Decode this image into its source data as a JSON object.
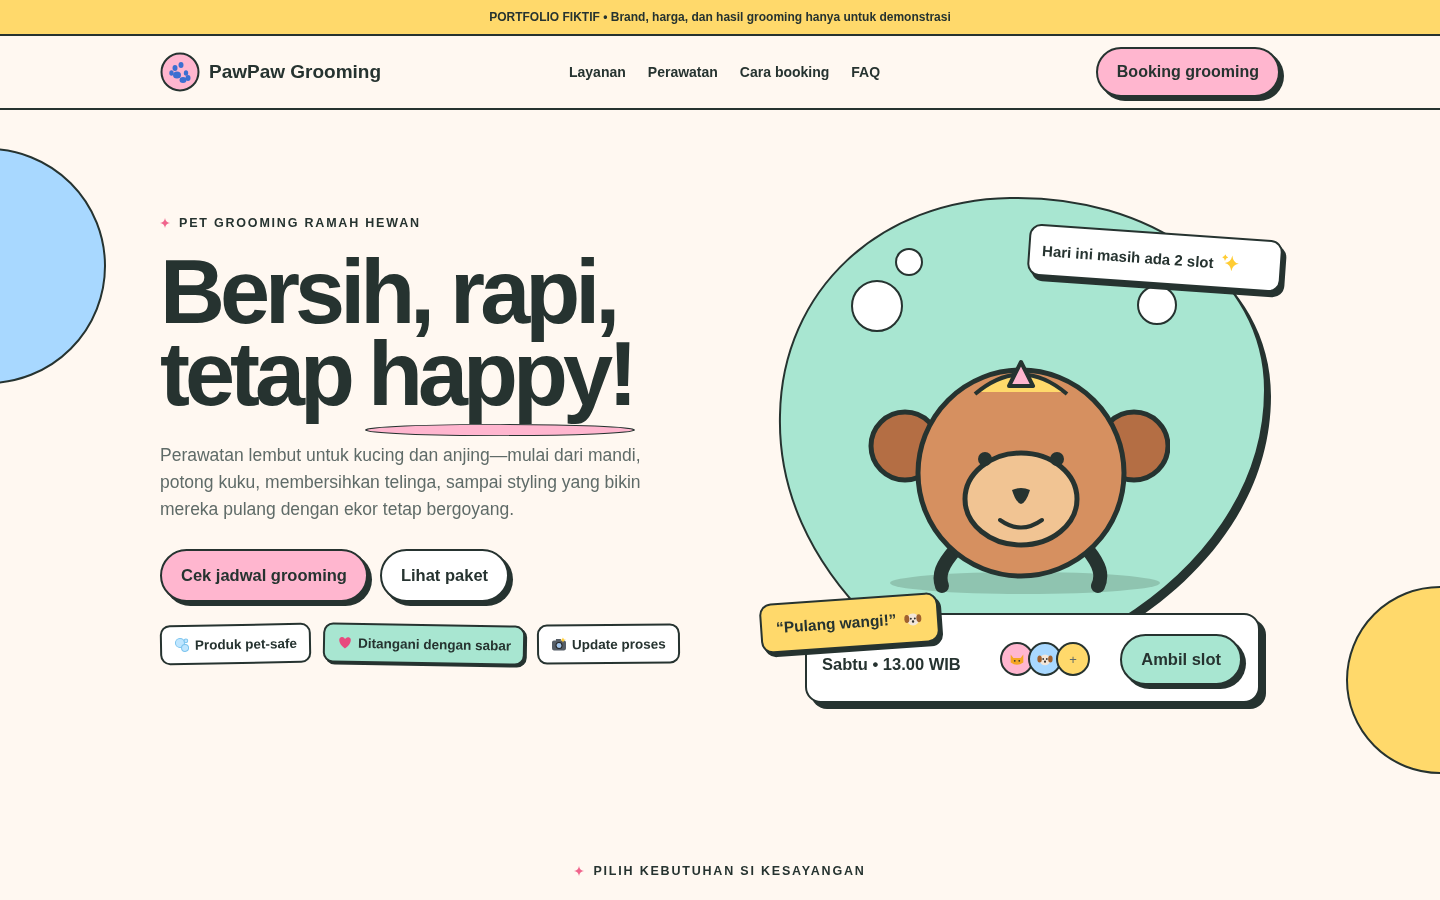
{
  "announcement": "PORTFOLIO FIKTIF • Brand, harga, dan hasil grooming hanya untuk demonstrasi",
  "brand": "PawPaw Grooming",
  "nav": [
    {
      "label": "Layanan"
    },
    {
      "label": "Perawatan"
    },
    {
      "label": "Cara booking"
    },
    {
      "label": "FAQ"
    }
  ],
  "nav_cta": "Booking grooming",
  "hero": {
    "eyebrow": "PET GROOMING RAMAH HEWAN",
    "title_line1": "Bersih, rapi,",
    "title_line2_plain": "tetap",
    "title_line2_highlight": "happy!",
    "lead": "Perawatan lembut untuk kucing dan anjing—mulai dari mandi, potong kuku, membersihkan telinga, sampai styling yang bikin mereka pulang dengan ekor tetap bergoyang.",
    "buttons": [
      {
        "label": "Cek jadwal grooming",
        "kind": "primary"
      },
      {
        "label": "Lihat paket",
        "kind": "secondary"
      }
    ],
    "chips": [
      {
        "label": "Produk pet-safe",
        "kind": "bubbles",
        "highlighted": false
      },
      {
        "label": "Ditangani dengan sabar",
        "kind": "heart",
        "highlighted": true
      },
      {
        "label": "Update proses",
        "kind": "camera",
        "highlighted": false
      }
    ]
  },
  "illustration": {
    "slot_sticker": "Hari ini masih ada 2 slot",
    "quote_sticker": "“Pulang wangi!”",
    "card": {
      "time": "Sabtu • 13.00 WIB",
      "avatars": [
        {
          "kind": "cat",
          "color": "#ffb6cf"
        },
        {
          "kind": "dog",
          "color": "#a8d8ff"
        },
        {
          "kind": "more",
          "label": "+",
          "color": "#ffd96b"
        }
      ],
      "button": "Ambil slot"
    }
  },
  "next_section": {
    "eyebrow": "PILIH KEBUTUHAN SI KESAYANGAN"
  }
}
